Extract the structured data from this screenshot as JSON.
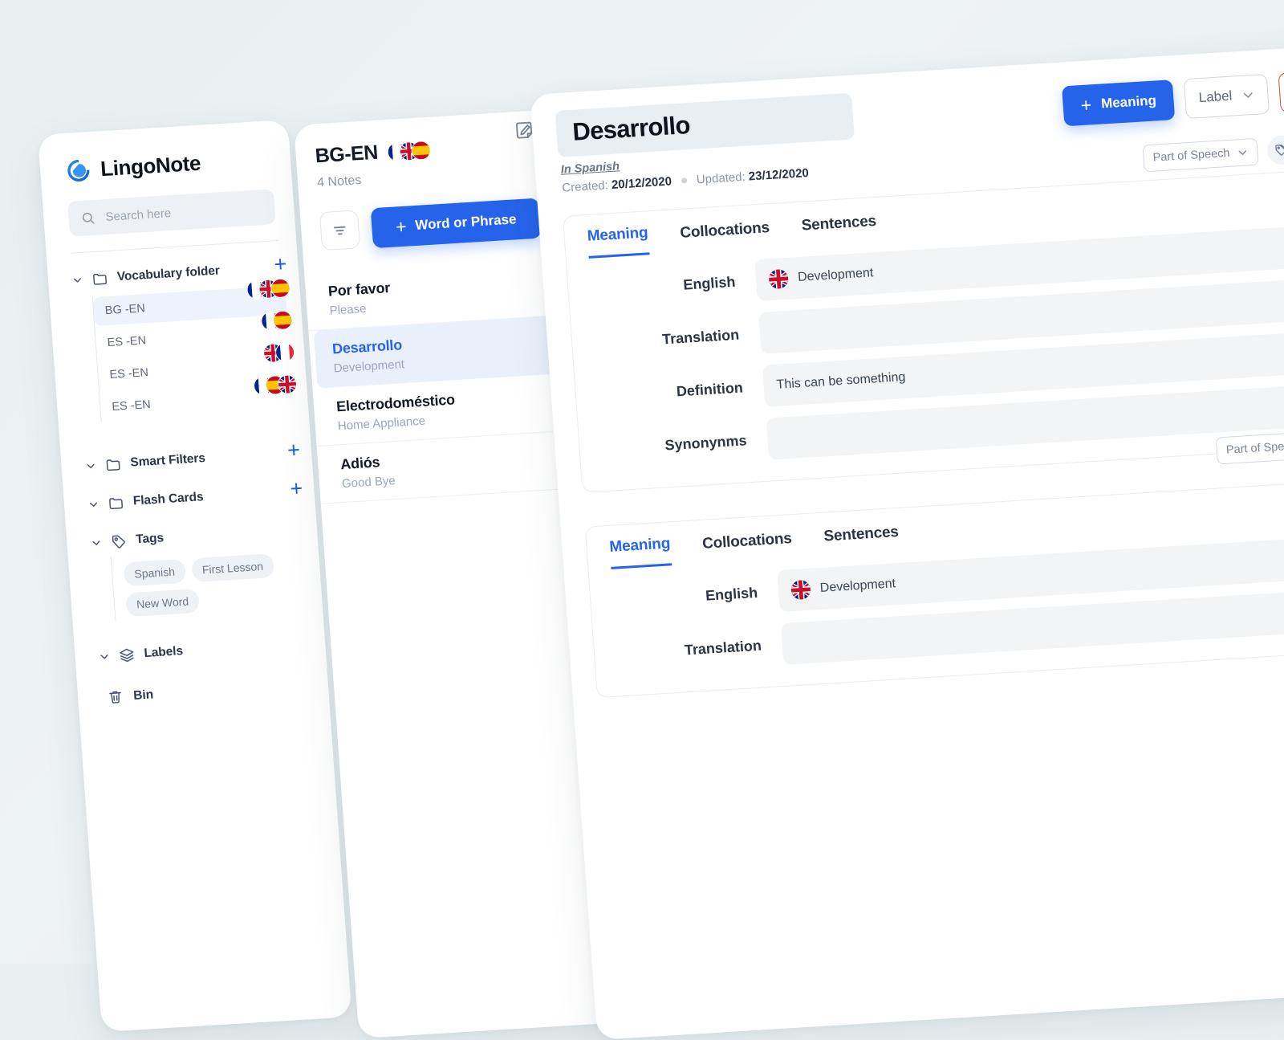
{
  "app": {
    "brand": "LingoNote",
    "logo_color": "#1f7ae0",
    "accent_color": "#2563eb",
    "danger_color": "#e0453c",
    "background_color": "#e9eff1"
  },
  "sidebar": {
    "search": {
      "placeholder": "Search here",
      "value": "",
      "icon": "search-icon"
    },
    "vocabulary": {
      "label": "Vocabulary folder",
      "icon": "folder-icon",
      "add_label": "+",
      "items": [
        {
          "label": "BG -EN",
          "active": true,
          "flags": [
            "fr",
            "gb",
            "es"
          ]
        },
        {
          "label": "ES -EN",
          "active": false,
          "flags": [
            "fr",
            "es"
          ]
        },
        {
          "label": "ES -EN",
          "active": false,
          "flags": [
            "gb",
            "fr"
          ]
        },
        {
          "label": "ES -EN",
          "active": false,
          "flags": [
            "fr",
            "es",
            "gb"
          ]
        }
      ]
    },
    "smart_filters": {
      "label": "Smart Filters",
      "icon": "folder-icon",
      "add_label": "+"
    },
    "flash_cards": {
      "label": "Flash Cards",
      "icon": "folder-icon",
      "add_label": "+"
    },
    "tags": {
      "label": "Tags",
      "icon": "tag-icon",
      "chips": [
        "Spanish",
        "First Lesson",
        "New Word"
      ]
    },
    "labels": {
      "label": "Labels",
      "icon": "layers-icon"
    },
    "bin": {
      "label": "Bin",
      "icon": "trash-icon"
    }
  },
  "notelist": {
    "title": "BG-EN",
    "flags": [
      "fr",
      "gb",
      "es"
    ],
    "count_label": "4 Notes",
    "edit_icon": "edit-note-icon",
    "filter_icon": "filter-icon",
    "add_button": {
      "label": "Word or Phrase",
      "plus": "+"
    },
    "notes": [
      {
        "word": "Por favor",
        "meaning": "Please",
        "selected": false
      },
      {
        "word": "Desarrollo",
        "meaning": "Development",
        "selected": true
      },
      {
        "word": "Electrodoméstico",
        "meaning": "Home Appliance",
        "selected": false
      },
      {
        "word": "Adiós",
        "meaning": "Good Bye",
        "selected": false
      }
    ]
  },
  "detail": {
    "title": "Desarrollo",
    "add_meaning_button": {
      "label": "Meaning",
      "plus": "+"
    },
    "label_dropdown": {
      "label": "Label",
      "chevron": "chevron-down-icon"
    },
    "delete_button": {
      "icon": "trash-icon"
    },
    "language_link": "In Spanish",
    "created_prefix": "Created:",
    "created_date": "20/12/2020",
    "updated_prefix": "Updated:",
    "updated_date": "23/12/2020",
    "part_of_speech_top": {
      "label": "Part of Speech",
      "chevron": "chevron-down-icon"
    },
    "tag_button_icon": "tags-icon",
    "meanings": [
      {
        "tabs": [
          {
            "label": "Meaning",
            "active": true
          },
          {
            "label": "Collocations",
            "active": false
          },
          {
            "label": "Sentences",
            "active": false
          }
        ],
        "fields": [
          {
            "label": "English",
            "value": "Development",
            "flag": "gb"
          },
          {
            "label": "Translation",
            "value": "",
            "flag": ""
          },
          {
            "label": "Definition",
            "value": "This can be something",
            "flag": ""
          },
          {
            "label": "Synonynms",
            "value": "",
            "flag": ""
          }
        ],
        "part_of_speech": {
          "label": "Part of Speech",
          "chevron": "chevron-down-icon"
        }
      },
      {
        "tabs": [
          {
            "label": "Meaning",
            "active": true
          },
          {
            "label": "Collocations",
            "active": false
          },
          {
            "label": "Sentences",
            "active": false
          }
        ],
        "fields": [
          {
            "label": "English",
            "value": "Development",
            "flag": "gb"
          },
          {
            "label": "Translation",
            "value": "",
            "flag": ""
          }
        ],
        "part_of_speech": null
      }
    ]
  }
}
